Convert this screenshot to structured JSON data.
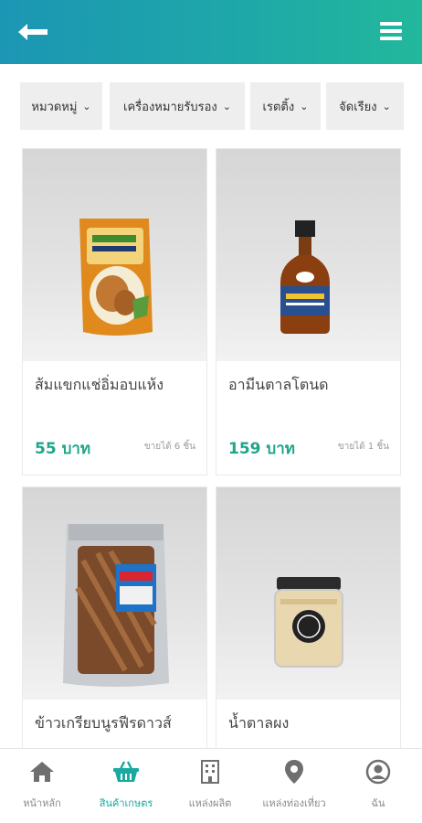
{
  "header": {
    "back_icon": "arrow-left-icon",
    "menu_icon": "hamburger-menu-icon",
    "gradient_start": "#1c96b4",
    "gradient_end": "#22b89c"
  },
  "filters": [
    {
      "label": "หมวดหมู่"
    },
    {
      "label": "เครื่องหมายรับรอง"
    },
    {
      "label": "เรตติ้ง"
    },
    {
      "label": "จัดเรียง"
    }
  ],
  "products": [
    {
      "name": "ส้มแขกแช่อิ่มอบแห้ง",
      "price": "55 บาท",
      "sold": "ขายได้ 6 ชิ้น"
    },
    {
      "name": "อามีนตาลโตนด",
      "price": "159 บาท",
      "sold": "ขายได้ 1 ชิ้น"
    },
    {
      "name": "ข้าวเกรียบนูรฟีรดาวส์",
      "price": "",
      "sold": ""
    },
    {
      "name": "น้ำตาลผง",
      "price": "",
      "sold": ""
    }
  ],
  "nav": [
    {
      "label": "หน้าหลัก",
      "icon": "home-icon"
    },
    {
      "label": "สินค้าเกษตร",
      "icon": "basket-icon",
      "active": true
    },
    {
      "label": "แหล่งผลิต",
      "icon": "building-icon"
    },
    {
      "label": "แหล่งท่องเที่ยว",
      "icon": "location-pin-icon"
    },
    {
      "label": "ฉัน",
      "icon": "user-icon"
    }
  ],
  "colors": {
    "accent": "#1fa58a",
    "nav_active": "#19a9a0"
  }
}
